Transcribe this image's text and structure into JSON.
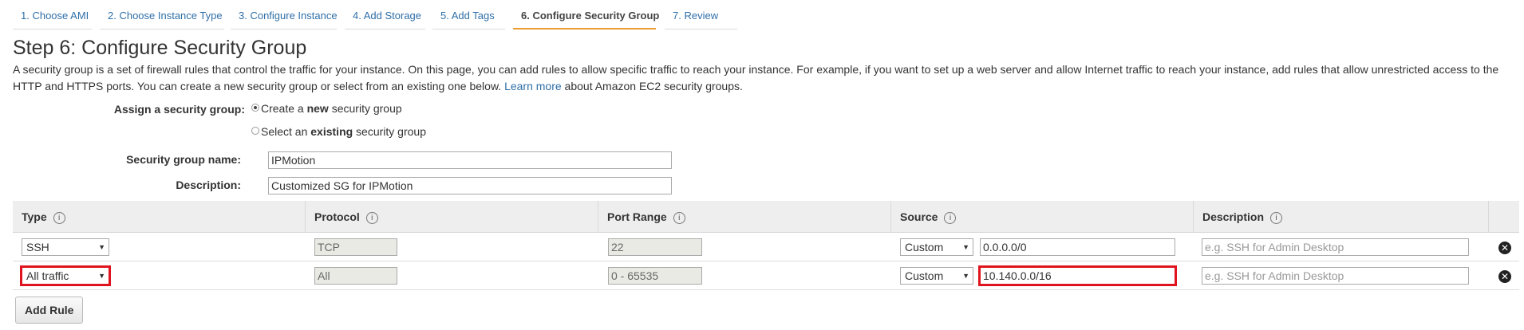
{
  "wizard_tabs": [
    {
      "label": "1. Choose AMI",
      "active": false
    },
    {
      "label": "2. Choose Instance Type",
      "active": false
    },
    {
      "label": "3. Configure Instance",
      "active": false
    },
    {
      "label": "4. Add Storage",
      "active": false
    },
    {
      "label": "5. Add Tags",
      "active": false
    },
    {
      "label": "6. Configure Security Group",
      "active": true
    },
    {
      "label": "7. Review",
      "active": false
    }
  ],
  "page": {
    "title": "Step 6: Configure Security Group",
    "intro_text": "A security group is a set of firewall rules that control the traffic for your instance. On this page, you can add rules to allow specific traffic to reach your instance. For example, if you want to set up a web server and allow Internet traffic to reach your instance, add rules that allow unrestricted access to the HTTP and HTTPS ports. You can create a new security group or select from an existing one below.",
    "learn_more_link": "Learn more",
    "intro_suffix": "about Amazon EC2 security groups."
  },
  "assign": {
    "label": "Assign a security group:",
    "option_new_pre": "Create a ",
    "option_new_bold": "new",
    "option_new_post": " security group",
    "option_existing_pre": "Select an ",
    "option_existing_bold": "existing",
    "option_existing_post": " security group",
    "selected": "new"
  },
  "form": {
    "name_label": "Security group name:",
    "name_value": "IPMotion",
    "description_label": "Description:",
    "description_value": "Customized SG for IPMotion"
  },
  "table": {
    "headers": [
      "Type",
      "Protocol",
      "Port Range",
      "Source",
      "Description"
    ],
    "info_icon": "i",
    "rows": [
      {
        "type": "SSH",
        "protocol": "TCP",
        "port_range": "22",
        "source_mode": "Custom",
        "source_value": "0.0.0.0/0",
        "description_placeholder": "e.g. SSH for Admin Desktop",
        "highlighted": false
      },
      {
        "type": "All traffic",
        "protocol": "All",
        "port_range": "0 - 65535",
        "source_mode": "Custom",
        "source_value": "10.140.0.0/16",
        "description_placeholder": "e.g. SSH for Admin Desktop",
        "highlighted": true
      }
    ],
    "remove_icon": "✕"
  },
  "actions": {
    "add_rule_label": "Add Rule"
  },
  "colors": {
    "link": "#2f6fa8",
    "active_tab_underline": "#ec9c2f",
    "highlight": "#e0141e",
    "header_bg": "#eeeeee"
  }
}
